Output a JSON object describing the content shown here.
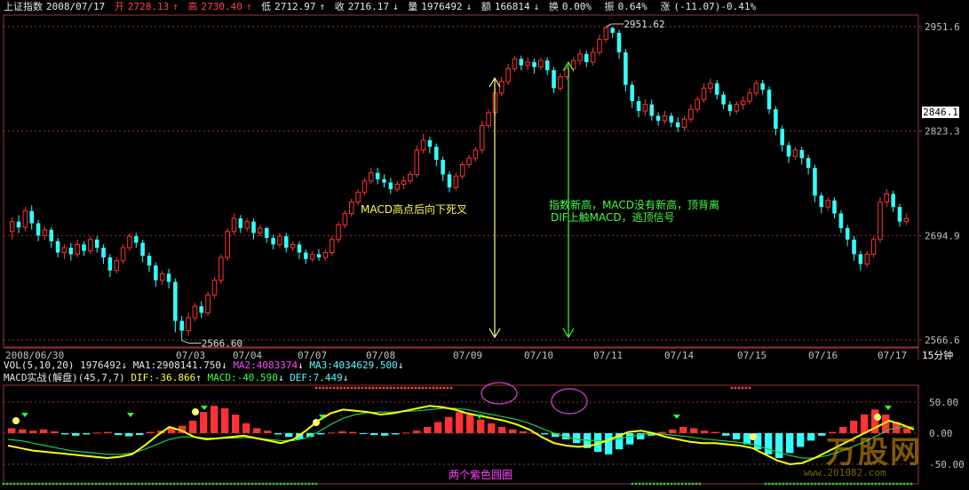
{
  "header": {
    "index_name": "上证指数",
    "date": "2008/07/17",
    "open_label": "开",
    "open_value": "2728.13",
    "high_label": "高",
    "high_value": "2730.40",
    "low_label": "低",
    "low_value": "2712.97",
    "close_label": "收",
    "close_value": "2716.17",
    "volume_label": "量",
    "volume_value": "1976492",
    "amount_label": "额",
    "amount_value": "166814",
    "turnover_label": "换",
    "turnover_value": "0.00%",
    "amplitude_label": "振",
    "amplitude_value": "0.64%",
    "change_label": "涨",
    "change_value": "(-11.07)-0.41%"
  },
  "price_axis": {
    "ticks": [
      "2951.6",
      "2823.3",
      "2694.9",
      "2566.6"
    ],
    "current_price_tag": "2846.1"
  },
  "markers": {
    "peak_value": "2951.62",
    "trough_value": "2566.60"
  },
  "date_axis": {
    "labels": [
      "2008/06/30",
      "07/03",
      "07/04",
      "07/07",
      "07/08",
      "07/09",
      "07/10",
      "07/11",
      "07/14",
      "07/15",
      "07/16",
      "07/17"
    ],
    "period": "15分钟"
  },
  "annotations": {
    "left_text": "MACD高点后向下死叉",
    "right_line1": "指数新高，MACD没有新高，顶背离",
    "right_line2": "DIF上触MACD，逃顶信号",
    "bottom_text": "两个紫色圆圈"
  },
  "vol_row": {
    "params": "VOL(5,10,20)",
    "vol": "1976492",
    "ma1": "MA1:2908141.750",
    "ma2": "MA2:4083374",
    "ma3": "MA3:4034629.500"
  },
  "macd_row": {
    "title": "MACD实战(解盘)(45,7,7)",
    "dif": "DIF:-36.866",
    "macd": "MACD:-40.590",
    "def": "DEF:7.449"
  },
  "macd_axis": {
    "ticks": [
      "50.00",
      "0.00",
      "-50.00"
    ]
  },
  "watermark": {
    "brand": "万股网",
    "url": "www.201082.com"
  },
  "colors": {
    "up": "#ff3333",
    "down": "#33ffff",
    "dif_line": "#ffff00",
    "macd_line": "#22cc44",
    "arrow_left": "#ffff88",
    "arrow_right": "#33ff33",
    "circle": "#cc44cc",
    "grid": "#993333"
  },
  "chart_data": {
    "type": "candlestick",
    "xlabel": "",
    "ylabel": "",
    "ylim": [
      2566.6,
      2951.6
    ],
    "series": [
      {
        "name": "",
        "values": [
          [
            2700,
            2712,
            2690,
            2718
          ],
          [
            2712,
            2705,
            2698,
            2720
          ],
          [
            2705,
            2725,
            2700,
            2730
          ],
          [
            2725,
            2710,
            2702,
            2732
          ],
          [
            2710,
            2695,
            2688,
            2714
          ],
          [
            2695,
            2702,
            2690,
            2706
          ],
          [
            2702,
            2688,
            2680,
            2705
          ],
          [
            2688,
            2674,
            2668,
            2692
          ],
          [
            2674,
            2680,
            2666,
            2684
          ],
          [
            2680,
            2672,
            2664,
            2686
          ],
          [
            2672,
            2684,
            2668,
            2690
          ],
          [
            2684,
            2676,
            2670,
            2688
          ],
          [
            2676,
            2690,
            2672,
            2694
          ],
          [
            2690,
            2680,
            2674,
            2694
          ],
          [
            2680,
            2668,
            2660,
            2684
          ],
          [
            2668,
            2652,
            2644,
            2672
          ],
          [
            2652,
            2664,
            2648,
            2668
          ],
          [
            2664,
            2680,
            2660,
            2684
          ],
          [
            2680,
            2694,
            2676,
            2698
          ],
          [
            2694,
            2686,
            2680,
            2698
          ],
          [
            2686,
            2670,
            2662,
            2690
          ],
          [
            2670,
            2658,
            2650,
            2674
          ],
          [
            2658,
            2640,
            2632,
            2662
          ],
          [
            2640,
            2648,
            2634,
            2652
          ],
          [
            2648,
            2638,
            2630,
            2654
          ],
          [
            2638,
            2590,
            2576,
            2642
          ],
          [
            2590,
            2578,
            2566,
            2596
          ],
          [
            2578,
            2594,
            2572,
            2600
          ],
          [
            2594,
            2608,
            2590,
            2612
          ],
          [
            2608,
            2600,
            2594,
            2614
          ],
          [
            2600,
            2622,
            2596,
            2626
          ],
          [
            2622,
            2640,
            2618,
            2644
          ],
          [
            2640,
            2668,
            2636,
            2672
          ],
          [
            2668,
            2700,
            2664,
            2704
          ],
          [
            2700,
            2716,
            2696,
            2722
          ],
          [
            2716,
            2704,
            2698,
            2720
          ],
          [
            2704,
            2712,
            2700,
            2716
          ],
          [
            2712,
            2698,
            2690,
            2716
          ],
          [
            2698,
            2704,
            2694,
            2708
          ],
          [
            2704,
            2692,
            2686,
            2706
          ],
          [
            2692,
            2684,
            2678,
            2696
          ],
          [
            2684,
            2694,
            2680,
            2698
          ],
          [
            2694,
            2680,
            2674,
            2698
          ],
          [
            2680,
            2684,
            2676,
            2688
          ],
          [
            2684,
            2674,
            2666,
            2688
          ],
          [
            2674,
            2666,
            2660,
            2678
          ],
          [
            2666,
            2672,
            2662,
            2676
          ],
          [
            2672,
            2668,
            2664,
            2678
          ],
          [
            2668,
            2674,
            2664,
            2678
          ],
          [
            2674,
            2690,
            2670,
            2694
          ],
          [
            2690,
            2708,
            2686,
            2712
          ],
          [
            2708,
            2722,
            2704,
            2726
          ],
          [
            2722,
            2736,
            2718,
            2740
          ],
          [
            2736,
            2748,
            2732,
            2752
          ],
          [
            2748,
            2762,
            2744,
            2766
          ],
          [
            2762,
            2772,
            2758,
            2778
          ],
          [
            2772,
            2764,
            2758,
            2778
          ],
          [
            2764,
            2760,
            2754,
            2770
          ],
          [
            2760,
            2752,
            2746,
            2766
          ],
          [
            2752,
            2758,
            2748,
            2762
          ],
          [
            2758,
            2762,
            2752,
            2768
          ],
          [
            2762,
            2770,
            2758,
            2774
          ],
          [
            2770,
            2800,
            2766,
            2806
          ],
          [
            2800,
            2812,
            2796,
            2820
          ],
          [
            2812,
            2804,
            2796,
            2816
          ],
          [
            2804,
            2788,
            2780,
            2808
          ],
          [
            2788,
            2770,
            2762,
            2792
          ],
          [
            2770,
            2754,
            2748,
            2774
          ],
          [
            2754,
            2768,
            2750,
            2772
          ],
          [
            2768,
            2782,
            2764,
            2786
          ],
          [
            2782,
            2790,
            2778,
            2794
          ],
          [
            2790,
            2800,
            2786,
            2804
          ],
          [
            2800,
            2830,
            2796,
            2836
          ],
          [
            2830,
            2846,
            2826,
            2850
          ],
          [
            2846,
            2870,
            2842,
            2876
          ],
          [
            2870,
            2884,
            2866,
            2890
          ],
          [
            2884,
            2900,
            2880,
            2906
          ],
          [
            2900,
            2912,
            2896,
            2916
          ],
          [
            2912,
            2904,
            2898,
            2916
          ],
          [
            2904,
            2908,
            2898,
            2914
          ],
          [
            2908,
            2902,
            2894,
            2912
          ],
          [
            2902,
            2910,
            2898,
            2914
          ],
          [
            2910,
            2898,
            2892,
            2914
          ],
          [
            2898,
            2876,
            2870,
            2902
          ],
          [
            2876,
            2890,
            2872,
            2894
          ],
          [
            2890,
            2900,
            2886,
            2904
          ],
          [
            2900,
            2910,
            2896,
            2914
          ],
          [
            2910,
            2918,
            2904,
            2924
          ],
          [
            2918,
            2908,
            2902,
            2922
          ],
          [
            2908,
            2920,
            2904,
            2926
          ],
          [
            2920,
            2936,
            2916,
            2942
          ],
          [
            2936,
            2950,
            2932,
            2951.6
          ],
          [
            2950,
            2944,
            2938,
            2951
          ],
          [
            2944,
            2920,
            2912,
            2948
          ],
          [
            2920,
            2880,
            2872,
            2924
          ],
          [
            2880,
            2860,
            2852,
            2884
          ],
          [
            2860,
            2848,
            2840,
            2866
          ],
          [
            2848,
            2856,
            2842,
            2862
          ],
          [
            2856,
            2842,
            2836,
            2862
          ],
          [
            2842,
            2836,
            2830,
            2846
          ],
          [
            2836,
            2842,
            2832,
            2848
          ],
          [
            2842,
            2834,
            2828,
            2846
          ],
          [
            2834,
            2828,
            2822,
            2840
          ],
          [
            2828,
            2838,
            2824,
            2842
          ],
          [
            2838,
            2850,
            2834,
            2856
          ],
          [
            2850,
            2862,
            2846,
            2866
          ],
          [
            2862,
            2876,
            2858,
            2882
          ],
          [
            2876,
            2882,
            2870,
            2888
          ],
          [
            2882,
            2868,
            2862,
            2886
          ],
          [
            2868,
            2856,
            2850,
            2872
          ],
          [
            2856,
            2848,
            2842,
            2860
          ],
          [
            2848,
            2856,
            2844,
            2860
          ],
          [
            2856,
            2860,
            2850,
            2866
          ],
          [
            2860,
            2870,
            2856,
            2876
          ],
          [
            2870,
            2882,
            2866,
            2886
          ],
          [
            2882,
            2874,
            2868,
            2886
          ],
          [
            2874,
            2850,
            2844,
            2878
          ],
          [
            2850,
            2826,
            2818,
            2854
          ],
          [
            2826,
            2806,
            2798,
            2830
          ],
          [
            2806,
            2792,
            2784,
            2810
          ],
          [
            2792,
            2800,
            2788,
            2804
          ],
          [
            2800,
            2790,
            2782,
            2804
          ],
          [
            2790,
            2778,
            2770,
            2794
          ],
          [
            2778,
            2744,
            2736,
            2782
          ],
          [
            2744,
            2730,
            2722,
            2748
          ],
          [
            2730,
            2738,
            2726,
            2742
          ],
          [
            2738,
            2722,
            2716,
            2742
          ],
          [
            2722,
            2704,
            2698,
            2726
          ],
          [
            2704,
            2690,
            2682,
            2708
          ],
          [
            2690,
            2672,
            2664,
            2694
          ],
          [
            2672,
            2660,
            2652,
            2676
          ],
          [
            2660,
            2672,
            2656,
            2676
          ],
          [
            2672,
            2690,
            2668,
            2694
          ],
          [
            2690,
            2736,
            2686,
            2742
          ],
          [
            2736,
            2746,
            2730,
            2752
          ],
          [
            2746,
            2730,
            2724,
            2750
          ],
          [
            2730,
            2712,
            2706,
            2734
          ],
          [
            2712,
            2716,
            2708,
            2722
          ]
        ]
      }
    ],
    "macd": {
      "ylim": [
        -60,
        60
      ],
      "histogram": [
        8,
        6,
        4,
        6,
        3,
        -2,
        -4,
        -2,
        1,
        2,
        -3,
        -5,
        -3,
        2,
        4,
        8,
        12,
        20,
        34,
        44,
        40,
        30,
        16,
        8,
        4,
        -2,
        -6,
        -10,
        -6,
        -2,
        1,
        3,
        2,
        -1,
        -3,
        -4,
        -2,
        1,
        4,
        10,
        18,
        26,
        34,
        30,
        22,
        16,
        10,
        6,
        3,
        1,
        -2,
        -6,
        -10,
        -16,
        -24,
        -30,
        -34,
        -26,
        -18,
        -10,
        -4,
        2,
        6,
        10,
        8,
        4,
        2,
        -4,
        -10,
        -18,
        -26,
        -34,
        -40,
        -32,
        -22,
        -12,
        -4,
        2,
        10,
        20,
        30,
        38,
        30,
        18,
        8
      ],
      "dif": [
        -20,
        -24,
        -28,
        -30,
        -32,
        -34,
        -36,
        -38,
        -40,
        -38,
        -34,
        -20,
        -4,
        10,
        4,
        -6,
        -10,
        -8,
        -6,
        -4,
        -8,
        -12,
        -16,
        -10,
        4,
        20,
        32,
        38,
        36,
        34,
        30,
        32,
        36,
        40,
        44,
        42,
        38,
        32,
        28,
        24,
        20,
        14,
        6,
        -6,
        -16,
        -20,
        -22,
        -20,
        -14,
        -6,
        2,
        4,
        0,
        -6,
        -10,
        -14,
        -16,
        -16,
        -18,
        -20,
        -24,
        -34,
        -44,
        -50,
        -48,
        -40,
        -30,
        -20,
        -10,
        0,
        10,
        20,
        14,
        6
      ],
      "macd_line": [
        -10,
        -12,
        -16,
        -20,
        -24,
        -28,
        -30,
        -32,
        -34,
        -34,
        -32,
        -26,
        -18,
        -10,
        -6,
        -6,
        -8,
        -8,
        -8,
        -7,
        -8,
        -10,
        -12,
        -12,
        -8,
        2,
        14,
        24,
        30,
        33,
        34,
        34,
        35,
        36,
        38,
        40,
        40,
        38,
        34,
        30,
        26,
        22,
        16,
        8,
        0,
        -6,
        -10,
        -12,
        -12,
        -10,
        -6,
        -2,
        0,
        -2,
        -4,
        -6,
        -9,
        -11,
        -13,
        -15,
        -18,
        -24,
        -30,
        -36,
        -40,
        -40,
        -36,
        -30,
        -22,
        -14,
        -4,
        6,
        10,
        10
      ]
    }
  }
}
